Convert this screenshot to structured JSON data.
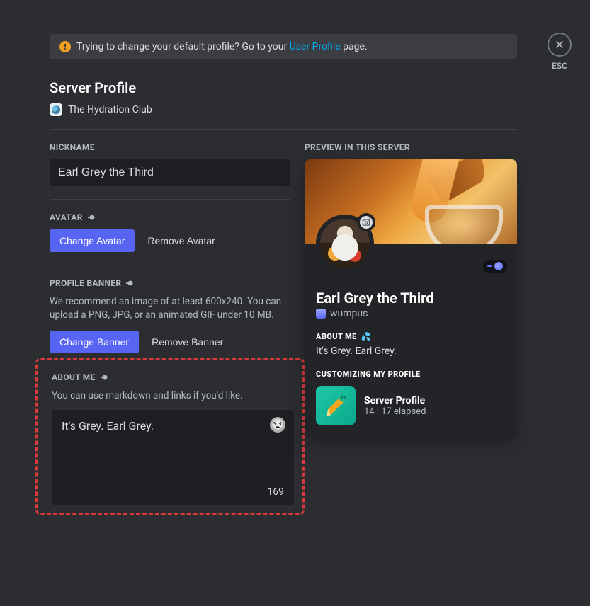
{
  "notice": {
    "prefix": "Trying to change your default profile? Go to your ",
    "link": "User Profile",
    "suffix": " page."
  },
  "page_title": "Server Profile",
  "server_name": "The Hydration Club",
  "nickname": {
    "label": "NICKNAME",
    "value": "Earl Grey the Third"
  },
  "avatar": {
    "label": "AVATAR",
    "change": "Change Avatar",
    "remove": "Remove Avatar"
  },
  "banner": {
    "label": "PROFILE BANNER",
    "hint": "We recommend an image of at least 600x240. You can upload a PNG, JPG, or an animated GIF under 10 MB.",
    "change": "Change Banner",
    "remove": "Remove Banner"
  },
  "about": {
    "label": "ABOUT ME",
    "hint": "You can use markdown and links if you'd like.",
    "value": "It's Grey. Earl Grey.",
    "remaining": "169"
  },
  "preview": {
    "label": "PREVIEW IN THIS SERVER",
    "display_name": "Earl Grey the Third",
    "username": "wumpus",
    "about_label": "ABOUT ME",
    "about_value": "It's Grey. Earl Grey.",
    "activity_label": "CUSTOMIZING MY PROFILE",
    "activity_name": "Server Profile",
    "activity_time": "14 : 17 elapsed"
  },
  "esc_label": "ESC"
}
